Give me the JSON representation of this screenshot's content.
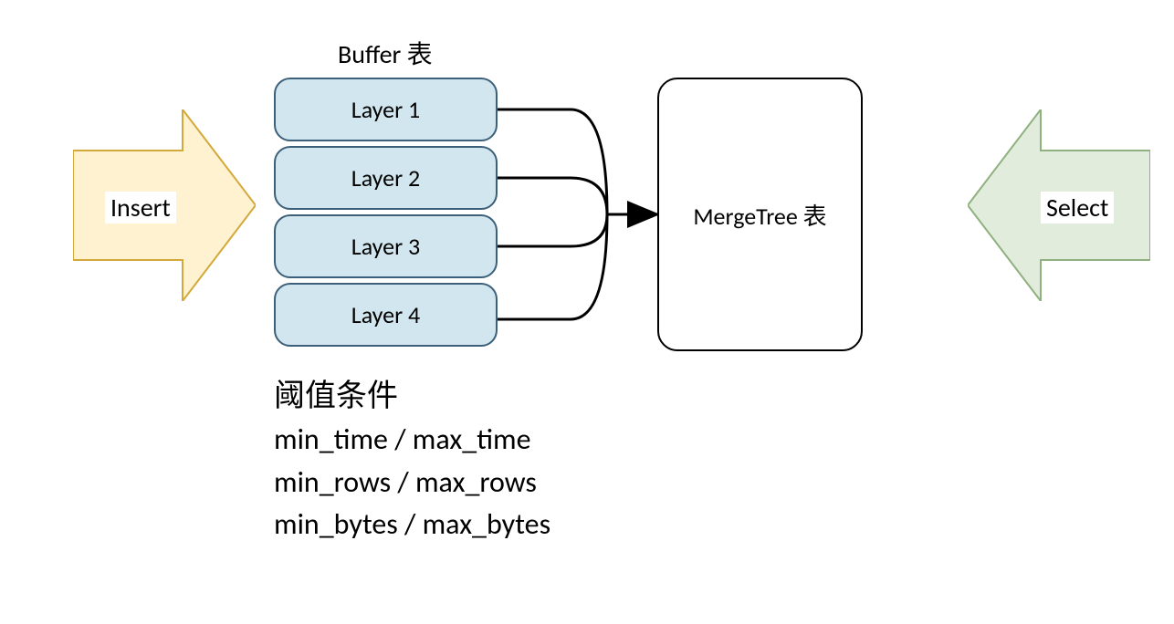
{
  "buffer": {
    "title": "Buffer 表",
    "layers": [
      "Layer 1",
      "Layer 2",
      "Layer 3",
      "Layer 4"
    ]
  },
  "mergetree": {
    "label": "MergeTree 表"
  },
  "left_arrow": {
    "label": "Insert",
    "fill": "#fef2d1",
    "stroke": "#d2a93a"
  },
  "right_arrow": {
    "label": "Select",
    "fill": "#e1ecdc",
    "stroke": "#8fb07f"
  },
  "threshold": {
    "title": "阈值条件",
    "lines": [
      "min_time / max_time",
      "min_rows / max_rows",
      "min_bytes / max_bytes"
    ]
  }
}
